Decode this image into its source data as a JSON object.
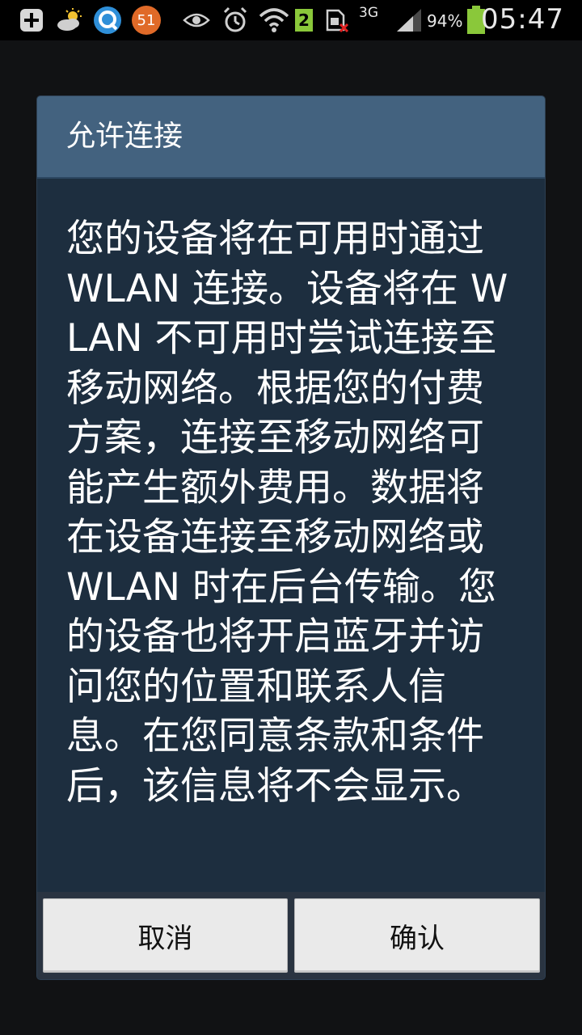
{
  "status_bar": {
    "icons": [
      "plus-icon",
      "weather-icon",
      "q-app-icon",
      "notification-badge",
      "eye-icon",
      "alarm-icon",
      "wifi-icon",
      "sim-badge",
      "sim-blocked-icon",
      "network-type",
      "signal-icon",
      "battery-icon"
    ],
    "notification_count": "51",
    "sim_number": "2",
    "network_type": "3G",
    "battery_percent": "94%",
    "time": "05:47"
  },
  "dialog": {
    "title": "允许连接",
    "message": "您的设备将在可用时通过 WLAN 连接。设备将在 WLAN 不可用时尝试连接至移动网络。根据您的付费方案，连接至移动网络可能产生额外费用。数据将在设备连接至移动网络或 WLAN 时在后台传输。您的设备也将开启蓝牙并访问您的位置和联系人信息。在您同意条款和条件后，该信息将不会显示。",
    "buttons": {
      "cancel_label": "取消",
      "ok_label": "确认"
    }
  },
  "colors": {
    "dialog_title_bg": "#43627f",
    "dialog_body_bg": "#1d2e3f",
    "button_bg": "#eaeaea"
  }
}
